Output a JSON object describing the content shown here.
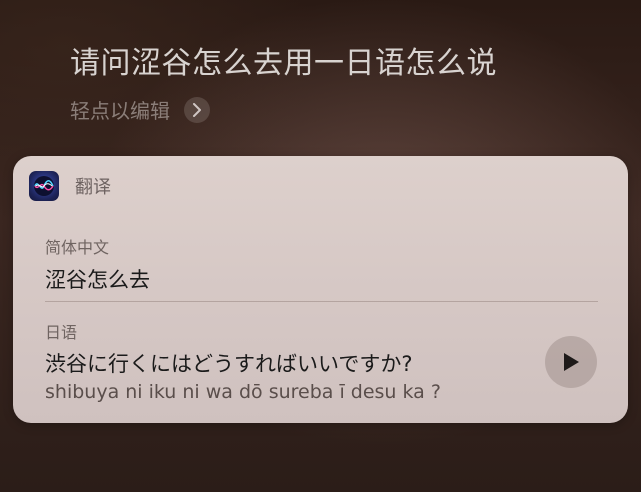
{
  "siri": {
    "query": "请问涩谷怎么去用一日语怎么说",
    "tap_to_edit": "轻点以编辑",
    "tap_to_edit_icon": "chevron-right-icon"
  },
  "card": {
    "app_icon": "siri-icon",
    "app_name": "翻译",
    "source": {
      "language": "简体中文",
      "text": "涩谷怎么去"
    },
    "target": {
      "language": "日语",
      "text": "渋谷に行くにはどうすればいいですか?",
      "romanization": "shibuya ni iku ni wa dō sureba ī desu ka ?"
    },
    "play_icon": "play-icon"
  }
}
